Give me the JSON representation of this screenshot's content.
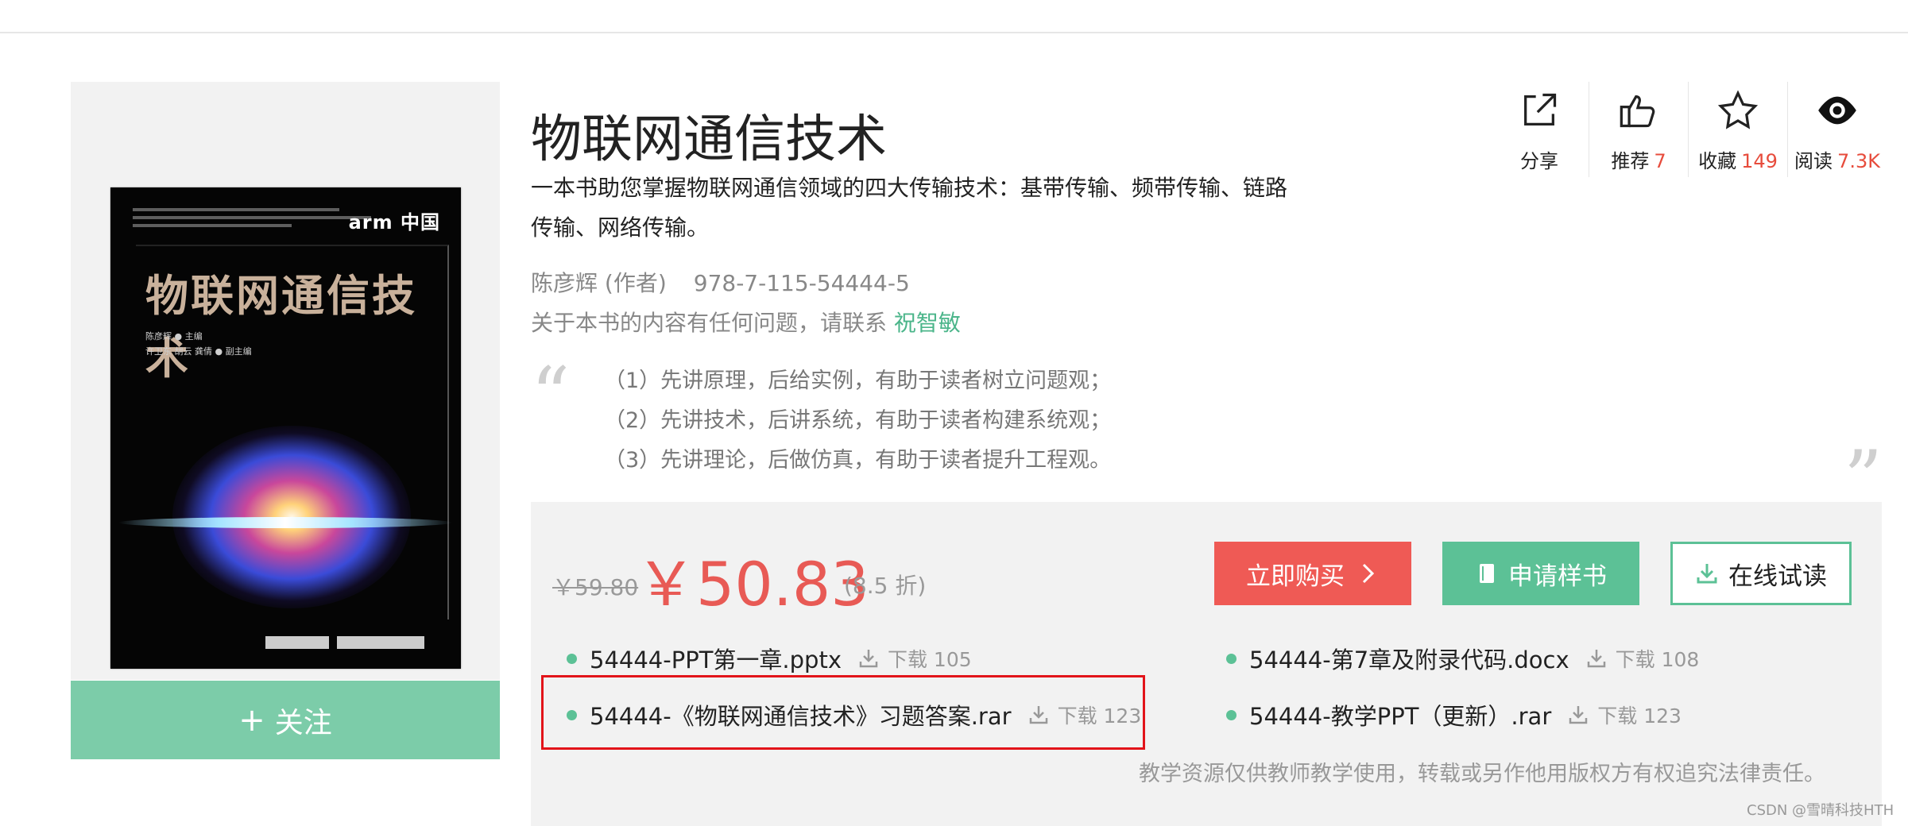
{
  "book": {
    "title": "物联网通信技术",
    "subtitle": "一本书助您掌握物联网通信领域的四大传输技术：基带传输、频带传输、链路传输、网络传输。",
    "author": "陈彦辉 (作者)",
    "isbn": "978-7-115-54444-5",
    "contact_prefix": "关于本书的内容有任何问题，请联系 ",
    "contact_name": "祝智敏",
    "features": [
      "（1）先讲原理，后给实例，有助于读者树立问题观；",
      "（2）先讲技术，后讲系统，有助于读者构建系统观；",
      "（3）先讲理论，后做仿真，有助于读者提升工程观。"
    ]
  },
  "cover": {
    "brand": "arm 中国",
    "title": "物联网通信技术",
    "authors": [
      "陈彦辉 ● 主编",
      "许卫东 胡云 龚倩 ● 副主编"
    ]
  },
  "follow_button": {
    "icon": "plus-icon",
    "label": "关注"
  },
  "actions": [
    {
      "name": "share",
      "icon": "share-icon",
      "label": "分享",
      "count": ""
    },
    {
      "name": "recommend",
      "icon": "thumbs-up-icon",
      "label": "推荐",
      "count": "7"
    },
    {
      "name": "favorite",
      "icon": "star-icon",
      "label": "收藏",
      "count": "149"
    },
    {
      "name": "read",
      "icon": "eye-icon",
      "label": "阅读",
      "count": "7.3K"
    }
  ],
  "price": {
    "original": "￥59.80",
    "current": "￥50.83",
    "discount": "(8.5 折)"
  },
  "buttons": {
    "buy": "立即购买",
    "sample": "申请样书",
    "trial": "在线试读"
  },
  "resources": [
    {
      "file": "54444-PPT第一章.pptx",
      "downloads": "下载 105"
    },
    {
      "file": "54444-第7章及附录代码.docx",
      "downloads": "下载 108"
    },
    {
      "file": "54444-《物联网通信技术》习题答案.rar",
      "downloads": "下载 123"
    },
    {
      "file": "54444-教学PPT（更新）.rar",
      "downloads": "下载 123"
    }
  ],
  "disclaimer": "教学资源仅供教师教学使用，转载或另作他用版权方有权追究法律责任。",
  "watermark": "CSDN @雪晴科技HTH",
  "colors": {
    "accent_green": "#5cc196",
    "price_red": "#e85a55",
    "buy_red": "#ef5a55",
    "highlight_red": "#e2141a"
  }
}
